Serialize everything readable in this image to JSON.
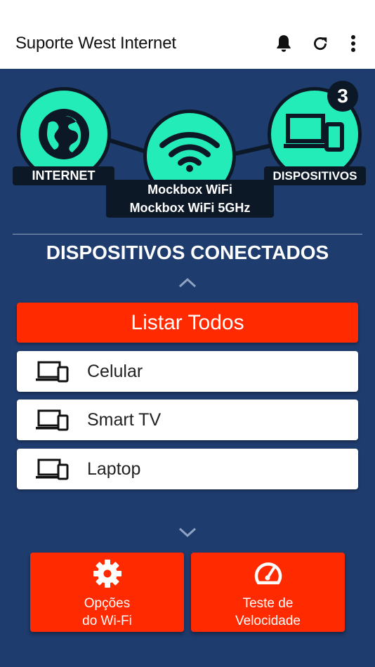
{
  "appbar": {
    "title": "Suporte West Internet",
    "actions": [
      "bell-icon",
      "refresh-icon",
      "more-vert-icon"
    ]
  },
  "network": {
    "internet_label": "INTERNET",
    "wifi_names": [
      "Mockbox WiFi",
      "Mockbox WiFi 5GHz"
    ],
    "devices_label": "DISPOSITIVOS",
    "devices_count": "3",
    "node_color": "#24ecb8"
  },
  "devices_section": {
    "title": "DISPOSITIVOS CONECTADOS",
    "list_all_label": "Listar Todos",
    "items": [
      {
        "label": "Celular",
        "icon": "devices-icon"
      },
      {
        "label": "Smart TV",
        "icon": "devices-icon"
      },
      {
        "label": "Laptop",
        "icon": "devices-icon"
      }
    ]
  },
  "actions": {
    "wifi_options": {
      "line1": "Opções",
      "line2": "do Wi-Fi",
      "icon": "gear-icon"
    },
    "speed_test": {
      "line1": "Teste de",
      "line2": "Velocidade",
      "icon": "speedometer-icon"
    }
  },
  "colors": {
    "background": "#1f3c6e",
    "accent": "#ff2a00",
    "node": "#24ecb8",
    "dark": "#0c1826"
  }
}
